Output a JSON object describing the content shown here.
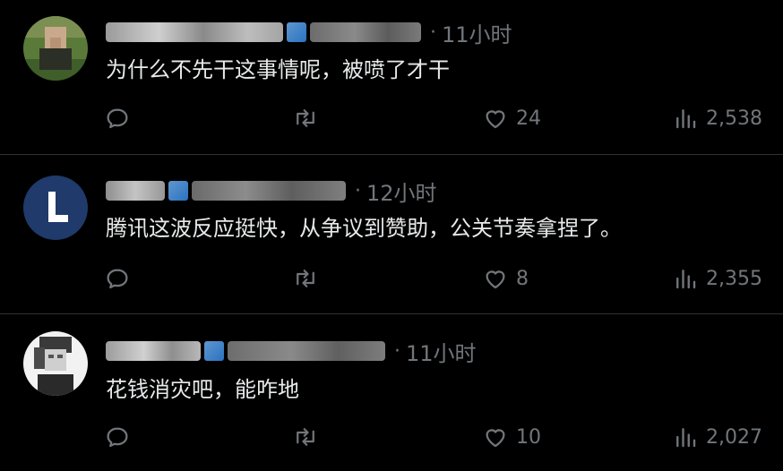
{
  "colors": {
    "background": "#000000",
    "text": "#e7e9ea",
    "muted": "#71767b",
    "divider": "#2f3336"
  },
  "tweets": [
    {
      "time": "11小时",
      "text": "为什么不先干这事情呢，被喷了才干",
      "likes": "24",
      "views": "2,538",
      "avatar": "blurred-person-avatar"
    },
    {
      "time": "12小时",
      "text": "腾讯这波反应挺快，从争议到赞助，公关节奏拿捏了。",
      "likes": "8",
      "views": "2,355",
      "avatar": "letter-l-avatar"
    },
    {
      "time": "11小时",
      "text": "花钱消灾吧，能咋地",
      "likes": "10",
      "views": "2,027",
      "avatar": "grayscale-person-avatar"
    }
  ],
  "icons": {
    "reply": "reply-icon",
    "retweet": "retweet-icon",
    "like": "heart-icon",
    "views": "views-icon"
  }
}
